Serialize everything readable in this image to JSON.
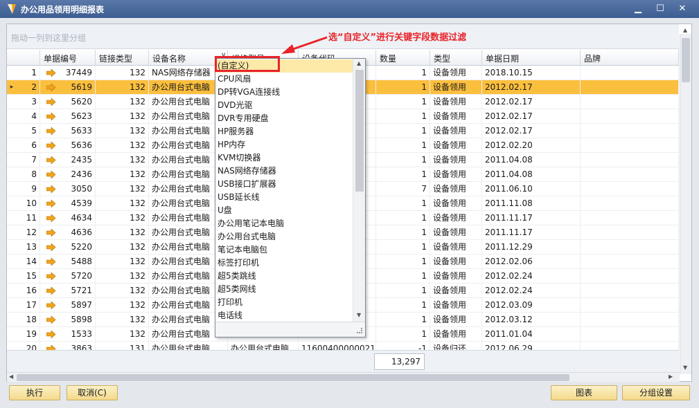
{
  "window": {
    "title": "办公用品领用明细报表",
    "min_glyph": "▁",
    "max_glyph": "☐",
    "close_glyph": "✕"
  },
  "grid": {
    "group_hint": "拖动一列到这里分组",
    "columns": [
      "",
      "单据编号",
      "链接类型",
      "设备名称",
      "规格型号",
      "设备代码",
      "数量",
      "类型",
      "单据日期",
      "品牌"
    ],
    "rows": [
      {
        "n": "1",
        "id": "37449",
        "link": "132",
        "name": "NAS网络存储器",
        "qty": "1",
        "type": "设备领用",
        "date": "2018.10.15"
      },
      {
        "n": "2",
        "id": "5619",
        "link": "132",
        "name": "办公用台式电脑",
        "qty": "1",
        "type": "设备领用",
        "date": "2012.02.17"
      },
      {
        "n": "3",
        "id": "5620",
        "link": "132",
        "name": "办公用台式电脑",
        "qty": "1",
        "type": "设备领用",
        "date": "2012.02.17"
      },
      {
        "n": "4",
        "id": "5623",
        "link": "132",
        "name": "办公用台式电脑",
        "qty": "1",
        "type": "设备领用",
        "date": "2012.02.17"
      },
      {
        "n": "5",
        "id": "5633",
        "link": "132",
        "name": "办公用台式电脑",
        "qty": "1",
        "type": "设备领用",
        "date": "2012.02.17"
      },
      {
        "n": "6",
        "id": "5636",
        "link": "132",
        "name": "办公用台式电脑",
        "qty": "1",
        "type": "设备领用",
        "date": "2012.02.20"
      },
      {
        "n": "7",
        "id": "2435",
        "link": "132",
        "name": "办公用台式电脑",
        "qty": "1",
        "type": "设备领用",
        "date": "2011.04.08"
      },
      {
        "n": "8",
        "id": "2436",
        "link": "132",
        "name": "办公用台式电脑",
        "qty": "1",
        "type": "设备领用",
        "date": "2011.04.08"
      },
      {
        "n": "9",
        "id": "3050",
        "link": "132",
        "name": "办公用台式电脑",
        "qty": "7",
        "type": "设备领用",
        "date": "2011.06.10"
      },
      {
        "n": "10",
        "id": "4539",
        "link": "132",
        "name": "办公用台式电脑",
        "qty": "1",
        "type": "设备领用",
        "date": "2011.11.08"
      },
      {
        "n": "11",
        "id": "4634",
        "link": "132",
        "name": "办公用台式电脑",
        "qty": "1",
        "type": "设备领用",
        "date": "2011.11.17"
      },
      {
        "n": "12",
        "id": "4636",
        "link": "132",
        "name": "办公用台式电脑",
        "qty": "1",
        "type": "设备领用",
        "date": "2011.11.17"
      },
      {
        "n": "13",
        "id": "5220",
        "link": "132",
        "name": "办公用台式电脑",
        "qty": "1",
        "type": "设备领用",
        "date": "2011.12.29"
      },
      {
        "n": "14",
        "id": "5488",
        "link": "132",
        "name": "办公用台式电脑",
        "qty": "1",
        "type": "设备领用",
        "date": "2012.02.06"
      },
      {
        "n": "15",
        "id": "5720",
        "link": "132",
        "name": "办公用台式电脑",
        "qty": "1",
        "type": "设备领用",
        "date": "2012.02.24"
      },
      {
        "n": "16",
        "id": "5721",
        "link": "132",
        "name": "办公用台式电脑",
        "qty": "1",
        "type": "设备领用",
        "date": "2012.02.24"
      },
      {
        "n": "17",
        "id": "5897",
        "link": "132",
        "name": "办公用台式电脑",
        "qty": "1",
        "type": "设备领用",
        "date": "2012.03.09"
      },
      {
        "n": "18",
        "id": "5898",
        "link": "132",
        "name": "办公用台式电脑",
        "qty": "1",
        "type": "设备领用",
        "date": "2012.03.12"
      },
      {
        "n": "19",
        "id": "1533",
        "link": "132",
        "name": "办公用台式电脑",
        "qty": "1",
        "type": "设备领用",
        "date": "2011.01.04"
      },
      {
        "n": "20",
        "id": "3863",
        "link": "131",
        "name": "办公用台式电脑",
        "spec": "办公用台式电脑",
        "code": "11600400000021",
        "qty": "-1",
        "type": "设备归还",
        "date": "2012.06.29"
      }
    ],
    "selected_row": 2,
    "row_indicator": "▸",
    "total_qty": "13,297"
  },
  "filter_dropdown": {
    "items": [
      "(自定义)",
      "CPU风扇",
      "DP转VGA连接线",
      "DVD光驱",
      "DVR专用硬盘",
      "HP服务器",
      "HP内存",
      "KVM切换器",
      "NAS网络存储器",
      "USB接口扩展器",
      "USB延长线",
      "U盘",
      "办公用笔记本电脑",
      "办公用台式电脑",
      "笔记本电脑包",
      "标签打印机",
      "超5类跳线",
      "超5类网线",
      "打印机",
      "电话线"
    ],
    "highlighted_index": 0
  },
  "annotation": {
    "text": "选“自定义”进行关键字段数据过滤",
    "color": "#e8232a"
  },
  "buttons": {
    "execute": "执行",
    "cancel": "取消(C)",
    "chart": "图表",
    "group_settings": "分组设置"
  },
  "colors": {
    "selected_row": "#fbbf3e",
    "titlebar": "#3d5e92",
    "button": "#f4d98a",
    "row_arrow": "#f0a51c"
  }
}
